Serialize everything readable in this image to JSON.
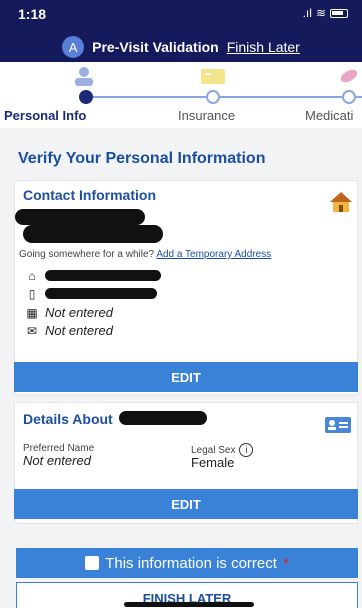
{
  "status": {
    "time": "1:18",
    "signal": ".ıl",
    "wifi": "≋"
  },
  "header": {
    "avatar_letter": "A",
    "title": "Pre-Visit Validation",
    "finish_later_link": "Finish Later"
  },
  "steps": [
    {
      "label": "Personal Info",
      "active": true
    },
    {
      "label": "Insurance",
      "active": false
    },
    {
      "label": "Medicati",
      "active": false
    }
  ],
  "section_title": "Verify Your Personal Information",
  "contact": {
    "title": "Contact Information",
    "temp_address_prompt": "Going somewhere for a while?",
    "temp_address_link": "Add a Temporary Address",
    "work_phone": "Not entered",
    "email": "Not entered",
    "edit_label": "EDIT"
  },
  "details": {
    "title": "Details About",
    "preferred_name_label": "Preferred Name",
    "preferred_name_value": "Not entered",
    "legal_sex_label": "Legal Sex",
    "legal_sex_value": "Female",
    "edit_label": "EDIT"
  },
  "confirm": {
    "label": "This information is correct",
    "required_mark": "*"
  },
  "finish_button": "FINISH LATER",
  "colors": {
    "header": "#141a5c",
    "accent": "#3a82d8",
    "title_blue": "#1b4fa0"
  }
}
